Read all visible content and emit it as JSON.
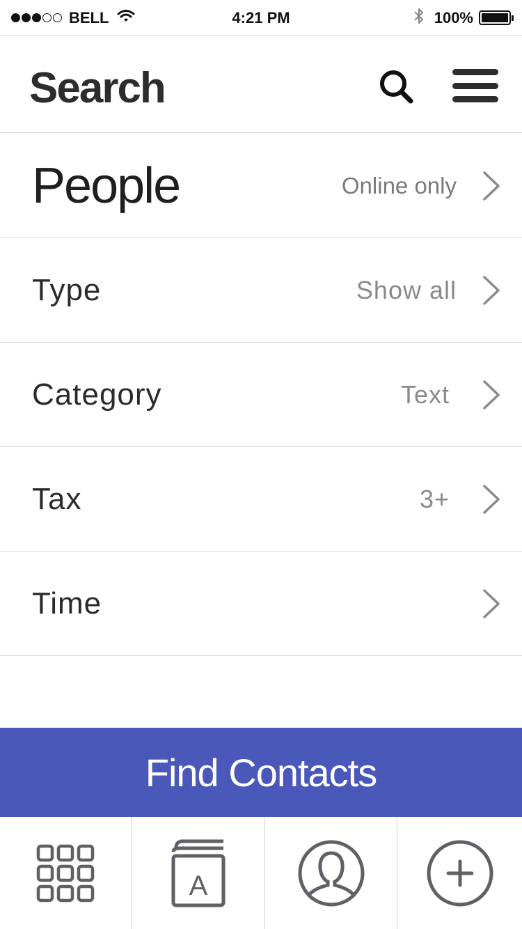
{
  "status_bar": {
    "carrier": "BELL",
    "time": "4:21 PM",
    "battery_percent": "100%",
    "signal_strength_bars": 3,
    "signal_total_bars": 5
  },
  "header": {
    "title": "Search",
    "search_icon": "search-icon",
    "menu_icon": "hamburger-menu-icon"
  },
  "filters": [
    {
      "label": "People",
      "value": "Online only"
    },
    {
      "label": "Type",
      "value": "Show all"
    },
    {
      "label": "Category",
      "value": "Text"
    },
    {
      "label": "Tax",
      "value": "3+"
    },
    {
      "label": "Time",
      "value": ""
    }
  ],
  "cta": {
    "label": "Find Contacts",
    "color": "#4a58b9"
  },
  "tabbar": {
    "tabs": [
      {
        "icon": "grid-icon"
      },
      {
        "icon": "address-book-icon",
        "glyph": "A"
      },
      {
        "icon": "profile-icon"
      },
      {
        "icon": "add-circle-icon"
      }
    ],
    "icon_color": "#5f6166"
  }
}
